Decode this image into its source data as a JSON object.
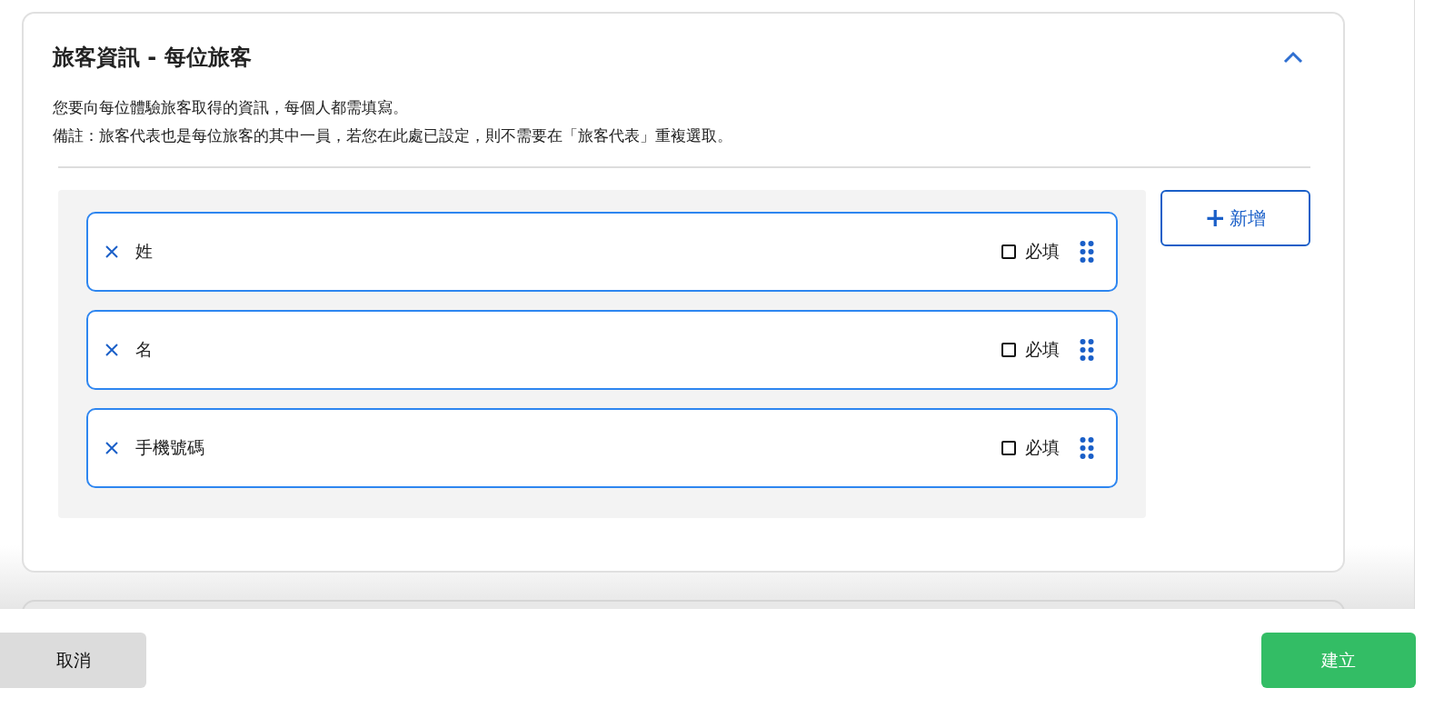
{
  "section": {
    "title": "旅客資訊 - 每位旅客",
    "expanded": true,
    "description": [
      "您要向每位體驗旅客取得的資訊，每個人都需填寫。",
      "備註：旅客代表也是每位旅客的其中一員，若您在此處已設定，則不需要在「旅客代表」重複選取。"
    ],
    "fields": [
      {
        "label": "姓",
        "required_label": "必填",
        "required": false
      },
      {
        "label": "名",
        "required_label": "必填",
        "required": false
      },
      {
        "label": "手機號碼",
        "required_label": "必填",
        "required": false
      }
    ],
    "add_button": {
      "icon": "+",
      "label": "新增"
    }
  },
  "footer": {
    "cancel": "取消",
    "create": "建立"
  }
}
